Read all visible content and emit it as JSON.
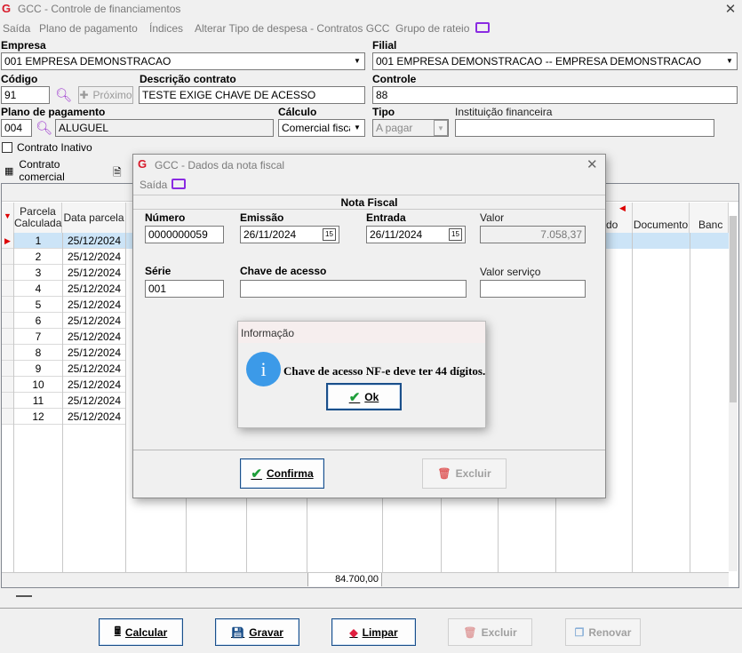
{
  "window": {
    "title": "GCC - Controle de financiamentos"
  },
  "menu": [
    "Saída",
    "Plano de pagamento",
    "Índices",
    "Alterar Tipo de despesa - Contratos GCC",
    "Grupo de rateio"
  ],
  "form": {
    "empresa_label": "Empresa",
    "empresa_value": "001 EMPRESA DEMONSTRACAO",
    "filial_label": "Filial",
    "filial_value": "001 EMPRESA DEMONSTRACAO -- EMPRESA DEMONSTRACAO",
    "codigo_label": "Código",
    "codigo_value": "91",
    "proximo_label": "Próximo",
    "descricao_label": "Descrição contrato",
    "descricao_value": "TESTE EXIGE CHAVE DE ACESSO",
    "controle_label": "Controle",
    "controle_value": "88",
    "plano_label": "Plano de pagamento",
    "plano_code": "004",
    "plano_value": "ALUGUEL",
    "calculo_label": "Cálculo",
    "calculo_value": "Comercial fiscal",
    "tipo_label": "Tipo",
    "tipo_value": "A pagar",
    "instituicao_label": "Instituição financeira",
    "instituicao_value": "",
    "inativo_label": "Contrato Inativo"
  },
  "tabs": {
    "contrato_comercial": "Contrato comercial"
  },
  "grid": {
    "headers": {
      "parcela": "Parcela Calculada",
      "data": "Data parcela",
      "do": "do",
      "documento": "Documento",
      "banco": "Banc"
    },
    "rows": [
      {
        "n": "1",
        "date": "25/12/2024"
      },
      {
        "n": "2",
        "date": "25/12/2024"
      },
      {
        "n": "3",
        "date": "25/12/2024"
      },
      {
        "n": "4",
        "date": "25/12/2024"
      },
      {
        "n": "5",
        "date": "25/12/2024"
      },
      {
        "n": "6",
        "date": "25/12/2024"
      },
      {
        "n": "7",
        "date": "25/12/2024"
      },
      {
        "n": "8",
        "date": "25/12/2024"
      },
      {
        "n": "9",
        "date": "25/12/2024"
      },
      {
        "n": "10",
        "date": "25/12/2024"
      },
      {
        "n": "11",
        "date": "25/12/2024"
      },
      {
        "n": "12",
        "date": "25/12/2024"
      }
    ],
    "total": "84.700,00"
  },
  "bottom_buttons": {
    "calcular": "Calcular",
    "gravar": "Gravar",
    "limpar": "Limpar",
    "excluir": "Excluir",
    "renovar": "Renovar"
  },
  "modal": {
    "title": "GCC - Dados da nota fiscal",
    "menu_saida": "Saída",
    "section": "Nota Fiscal",
    "numero_label": "Número",
    "numero_value": "0000000059",
    "emissao_label": "Emissão",
    "emissao_value": "26/11/2024",
    "entrada_label": "Entrada",
    "entrada_value": "26/11/2024",
    "valor_label": "Valor",
    "valor_value": "7.058,37",
    "serie_label": "Série",
    "serie_value": "001",
    "chave_label": "Chave de acesso",
    "chave_value": "",
    "valor_servico_label": "Valor serviço",
    "valor_servico_value": "",
    "confirma": "Confirma",
    "excluir": "Excluir"
  },
  "info": {
    "title": "Informação",
    "message": "Chave de acesso NF-e deve ter 44 dígitos.",
    "ok": "Ok"
  },
  "colors": {
    "logo": "#d81a2a",
    "selection": "#cce4f7",
    "info_icon": "#3c9ae8",
    "check": "#1e9e3a",
    "monitor": "#8a2be2"
  }
}
